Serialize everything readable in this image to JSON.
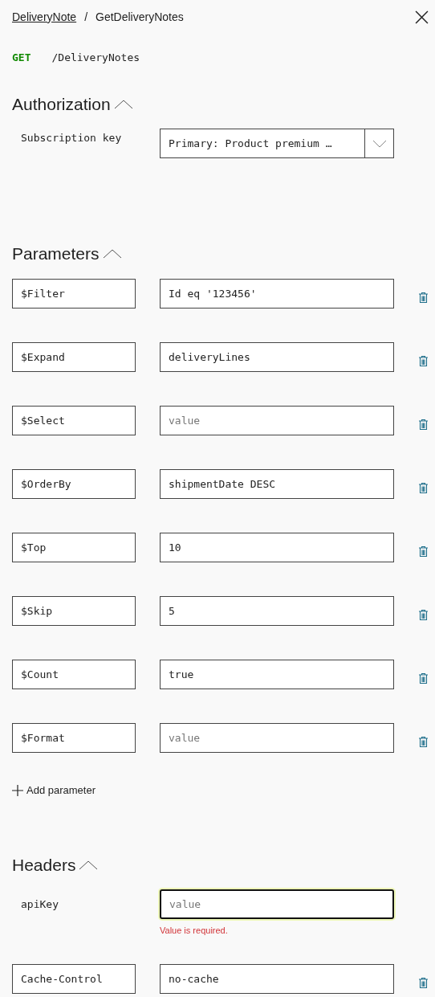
{
  "breadcrumb": [
    {
      "text": "DeliveryNote",
      "link": true
    },
    {
      "text": "GetDeliveryNotes",
      "link": false
    }
  ],
  "separator": "/",
  "method": "GET",
  "path": "/DeliveryNotes",
  "authorization": {
    "title": "Authorization",
    "expanded": true,
    "label": "Subscription key",
    "value": "Primary: Product premium …"
  },
  "parameters": {
    "title": "Parameters",
    "expanded": true,
    "rows": [
      {
        "name": "$Filter",
        "value": "Id eq '123456'"
      },
      {
        "name": "$Expand",
        "value": "deliveryLines"
      },
      {
        "name": "$Select",
        "placeholder": "value"
      },
      {
        "name": "$OrderBy",
        "value": "shipmentDate DESC"
      },
      {
        "name": "$Top",
        "value": "10"
      },
      {
        "name": "$Skip",
        "value": "5"
      },
      {
        "name": "$Count",
        "value": "true"
      },
      {
        "name": "$Format",
        "placeholder": "value"
      }
    ],
    "add_label": "Add parameter"
  },
  "headers": {
    "title": "Headers",
    "expanded": true,
    "rows": [
      {
        "kind": "fixed",
        "name": "apiKey",
        "placeholder": "value",
        "focused": true,
        "error": "Value is required."
      },
      {
        "kind": "editable",
        "name": "Cache-Control",
        "value": "no-cache"
      }
    ]
  }
}
